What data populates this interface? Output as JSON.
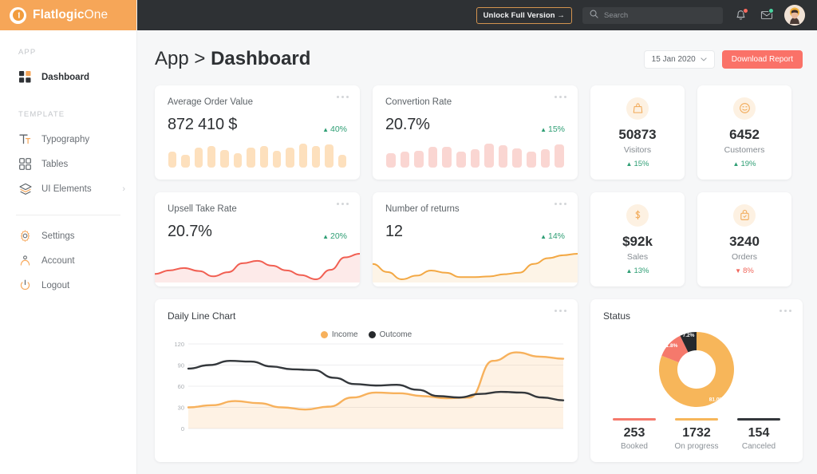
{
  "brand": {
    "name_bold": "Flatlogic",
    "name_light": "One",
    "logo_icon": "flatlogic-logo-icon"
  },
  "sidebar": {
    "sections": [
      {
        "label": "APP",
        "items": [
          {
            "label": "Dashboard",
            "icon": "dashboard-grid-icon",
            "active": true
          }
        ]
      },
      {
        "label": "TEMPLATE",
        "items": [
          {
            "label": "Typography",
            "icon": "typography-icon",
            "active": false
          },
          {
            "label": "Tables",
            "icon": "tables-grid-icon",
            "active": false
          },
          {
            "label": "UI Elements",
            "icon": "layers-icon",
            "active": false,
            "chevron": "›"
          }
        ]
      }
    ],
    "footer_items": [
      {
        "label": "Settings",
        "icon": "gear-icon"
      },
      {
        "label": "Account",
        "icon": "user-icon"
      },
      {
        "label": "Logout",
        "icon": "power-icon"
      }
    ]
  },
  "topbar": {
    "unlock_label": "Unlock Full Version  →",
    "search_placeholder": "Search",
    "search_value": "",
    "search_icon": "search-icon",
    "bell_icon": "bell-icon",
    "mail_icon": "mail-icon",
    "avatar_icon": "user-avatar"
  },
  "page": {
    "breadcrumb_prefix": "App > ",
    "breadcrumb_current": "Dashboard",
    "date_label": "15 Jan 2020",
    "date_chevron": "⌄",
    "download_label": "Download Report"
  },
  "metrics": [
    {
      "title": "Average Order Value",
      "value": "872 410 $",
      "delta": "40%",
      "delta_dir": "up",
      "spark_type": "bars",
      "spark_color": "#fde0bd"
    },
    {
      "title": "Convertion Rate",
      "value": "20.7%",
      "delta": "15%",
      "delta_dir": "up",
      "spark_type": "bars",
      "spark_color": "#fad6d2"
    },
    {
      "title": "Upsell Take Rate",
      "value": "20.7%",
      "delta": "20%",
      "delta_dir": "up",
      "spark_type": "line",
      "spark_color": "#f15f52"
    },
    {
      "title": "Number of returns",
      "value": "12",
      "delta": "14%",
      "delta_dir": "up",
      "spark_type": "line",
      "spark_color": "#f3a844"
    }
  ],
  "stats": [
    {
      "value": "50873",
      "label": "Visitors",
      "delta": "15%",
      "delta_dir": "up",
      "icon": "bag-icon"
    },
    {
      "value": "6452",
      "label": "Customers",
      "delta": "19%",
      "delta_dir": "up",
      "icon": "smiley-icon"
    },
    {
      "value": "$92k",
      "label": "Sales",
      "delta": "13%",
      "delta_dir": "up",
      "icon": "dollar-icon"
    },
    {
      "value": "3240",
      "label": "Orders",
      "delta": "8%",
      "delta_dir": "down",
      "icon": "lock-bag-icon"
    }
  ],
  "status": {
    "title": "Status",
    "legend": [
      {
        "value": "253",
        "label": "Booked",
        "color": "#f5796c"
      },
      {
        "value": "1732",
        "label": "On progress",
        "color": "#f7b65a"
      },
      {
        "value": "154",
        "label": "Canceled",
        "color": "#33373b"
      }
    ]
  },
  "colors": {
    "brand_orange": "#f6a658",
    "income": "#f7b15c",
    "outcome": "#2e3134",
    "danger": "#fa7268",
    "success": "#2e9e74"
  },
  "chart_data": [
    {
      "type": "line",
      "title": "Daily Line Chart",
      "xlabel": "",
      "ylabel": "",
      "ylim": [
        0,
        120
      ],
      "yticks": [
        0,
        30,
        60,
        90,
        120
      ],
      "grid": true,
      "legend_position": "top-center",
      "x": [
        0,
        1,
        2,
        3,
        4,
        5,
        6,
        7,
        8,
        9,
        10,
        11,
        12,
        13,
        14,
        15
      ],
      "series": [
        {
          "name": "Income",
          "color": "#f7b15c",
          "values": [
            30,
            33,
            39,
            36,
            30,
            27,
            31,
            44,
            51,
            50,
            46,
            43,
            44,
            96,
            108,
            102,
            99
          ]
        },
        {
          "name": "Outcome",
          "color": "#33373b",
          "values": [
            85,
            90,
            96,
            95,
            88,
            84,
            83,
            72,
            63,
            61,
            62,
            55,
            46,
            44,
            49,
            52,
            51,
            44,
            40
          ]
        }
      ]
    },
    {
      "type": "pie",
      "title": "Status",
      "labels": [
        "On progress",
        "Booked",
        "Canceled"
      ],
      "values": [
        81.0,
        11.8,
        7.2
      ],
      "value_suffix": "%",
      "counts": [
        1732,
        253,
        154
      ],
      "colors": [
        "#f7b65a",
        "#f5796c",
        "#26292c"
      ],
      "donut": true
    },
    {
      "type": "bar",
      "title": "Average Order Value",
      "values": [
        60,
        48,
        74,
        80,
        66,
        53,
        72,
        78,
        63,
        72,
        88,
        80,
        86,
        47
      ],
      "color": "#fde0bd"
    },
    {
      "type": "bar",
      "title": "Convertion Rate",
      "values": [
        56,
        62,
        65,
        80,
        81,
        60,
        70,
        92,
        85,
        74,
        61,
        72,
        90
      ],
      "color": "#fad6d2"
    },
    {
      "type": "area",
      "title": "Upsell Take Rate",
      "values": [
        30,
        36,
        40,
        35,
        26,
        33,
        48,
        52,
        44,
        36,
        28,
        21,
        37,
        58,
        64
      ],
      "color": "#f15f52"
    },
    {
      "type": "area",
      "title": "Number of returns",
      "values": [
        44,
        33,
        23,
        28,
        35,
        32,
        26,
        26,
        27,
        30,
        32,
        44,
        52,
        56,
        58
      ],
      "color": "#f3a844"
    }
  ]
}
